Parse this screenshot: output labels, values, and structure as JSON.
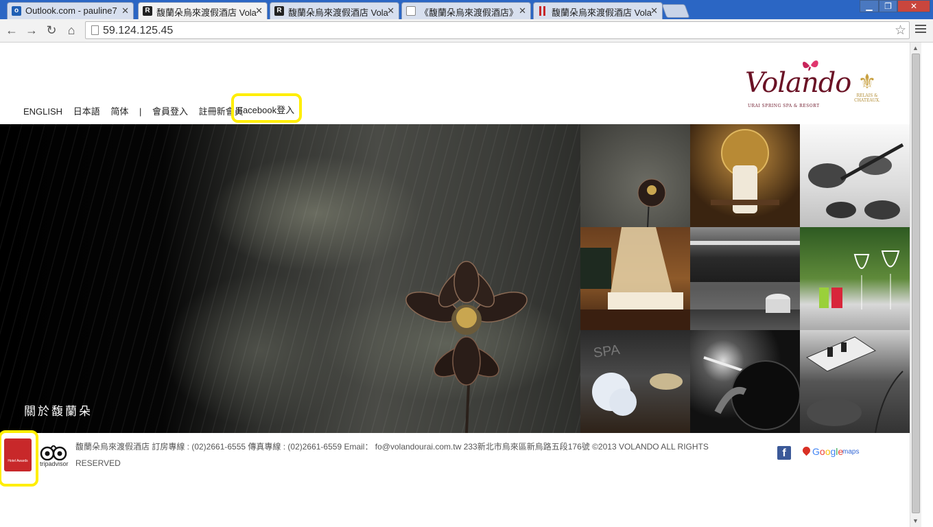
{
  "browser": {
    "tabs": [
      {
        "title": "Outlook.com - pauline7",
        "favicon": "outlook-icon",
        "color": "#1f5fb4",
        "active": false
      },
      {
        "title": "馥蘭朵烏來渡假酒店 Vola",
        "favicon": "R",
        "color": "#222222",
        "active": true
      },
      {
        "title": "馥蘭朵烏來渡假酒店 Vola",
        "favicon": "R",
        "color": "#222222",
        "active": false
      },
      {
        "title": "《馥蘭朵烏來渡假酒店》",
        "favicon": "page-icon",
        "color": "#888888",
        "active": false
      },
      {
        "title": "馥蘭朵烏來渡假酒店 Vola",
        "favicon": "bars-icon",
        "color": "#c8282a",
        "active": false
      }
    ],
    "url": "59.124.125.45"
  },
  "page": {
    "nav": {
      "english": "ENGLISH",
      "japanese": "日本語",
      "simplified": "简体",
      "separator": "|",
      "member_login": "會員登入",
      "register": "註冊新會員",
      "facebook_login": "Facebook登入"
    },
    "logo": {
      "name": "Volando",
      "tagline": "URAI SPRING SPA & RESORT",
      "partner": "RELAIS &\nCHATEAUX."
    },
    "hero": {
      "caption": "關於馥蘭朵"
    },
    "gallery": [
      "lotus-rain",
      "gong-ceremony",
      "singing-bowls",
      "canopy-bedroom",
      "spa-pool",
      "dining-glasses",
      "spa-flowers",
      "drum-performance",
      "outdoor-lounge"
    ],
    "footer": {
      "text": "馥蘭朵烏來渡假酒店 訂房專線 : (02)2661-6555 傳真專線 : (02)2661-6559 Email： fo@volandourai.com.tw 233新北市烏來區新烏路五段176號 ©2013 VOLANDO ALL RIGHTS RESERVED",
      "award_text": "Hotel Awards",
      "tripadvisor": "tripadvisor",
      "google_maps": "maps",
      "google_word": "Google"
    }
  },
  "colors": {
    "brand": "#6a1225",
    "highlight": "#ffee00",
    "facebook": "#3b5998"
  }
}
